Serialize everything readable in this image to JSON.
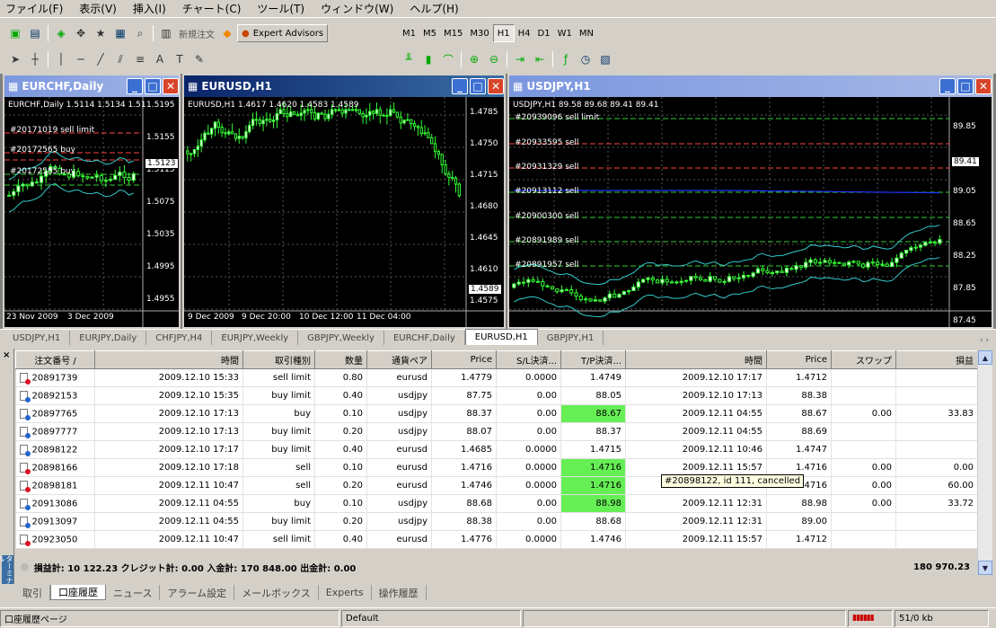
{
  "menu": [
    "ファイル(F)",
    "表示(V)",
    "挿入(I)",
    "チャート(C)",
    "ツール(T)",
    "ウィンドウ(W)",
    "ヘルプ(H)"
  ],
  "toolbar": {
    "new_order": "新規注文",
    "expert_advisors": "Expert Advisors",
    "timeframes": [
      "M1",
      "M5",
      "M15",
      "M30",
      "H1",
      "H4",
      "D1",
      "W1",
      "MN"
    ],
    "active_timeframe": "H1"
  },
  "charts": {
    "eurchf": {
      "title": "EURCHF,Daily",
      "info": "EURCHF,Daily  1.5114 1.5134 1.51",
      "orders": [
        "#20171019 sell limit",
        "#20172565 buy",
        "#20172585 buy"
      ],
      "price_labels": [
        "1.5195",
        "1.5155",
        "1.5115",
        "1.5075",
        "1.5035",
        "1.4995",
        "1.4955"
      ],
      "current_price": "1.5123",
      "date_labels": [
        "23 Nov 2009",
        "3 Dec 2009"
      ]
    },
    "eurusd": {
      "title": "EURUSD,H1",
      "info": "EURUSD,H1  1.4617 1.4620 1.4583 1.4589",
      "price_labels": [
        "1.4785",
        "1.4750",
        "1.4715",
        "1.4680",
        "1.4645",
        "1.4610",
        "1.4575"
      ],
      "current_price": "1.4589",
      "date_labels": [
        "9 Dec 2009",
        "9 Dec 20:00",
        "10 Dec 12:00",
        "11 Dec 04:00"
      ]
    },
    "usdjpy": {
      "title": "USDJPY,H1",
      "info": "USDJPY,H1  89.58 89.68 89.41 89.41",
      "orders": [
        "#20939096 sell limit",
        "#20933595 sell",
        "#20931329 sell",
        "#20913112 sell",
        "#20900300 sell",
        "#20891989 sell",
        "#20891957 sell"
      ],
      "price_labels": [
        "89.85",
        "89.05",
        "88.65",
        "88.25",
        "87.85",
        "87.45"
      ],
      "current_price": "89.41"
    }
  },
  "chart_tabs": [
    "USDJPY,H1",
    "EURJPY,Daily",
    "CHFJPY,H4",
    "EURJPY,Weekly",
    "GBPJPY,Weekly",
    "EURCHF,Daily",
    "EURUSD,H1",
    "GBPJPY,H1"
  ],
  "active_chart_tab": "EURUSD,H1",
  "terminal": {
    "columns": [
      "注文番号 /",
      "時間",
      "取引種別",
      "数量",
      "通貨ペア",
      "Price",
      "S/L決済...",
      "T/P決済...",
      "時間",
      "Price",
      "スワップ",
      "損益"
    ],
    "rows": [
      {
        "ticket": "20891739",
        "open_time": "2009.12.10 15:33",
        "type": "sell limit",
        "size": "0.80",
        "symbol": "eurusd",
        "price": "1.4779",
        "sl": "0.0000",
        "tp": "1.4749",
        "close_time": "2009.12.10 17:17",
        "close_price": "1.4712",
        "swap": "",
        "profit": ""
      },
      {
        "ticket": "20892153",
        "open_time": "2009.12.10 15:35",
        "type": "buy limit",
        "size": "0.40",
        "symbol": "usdjpy",
        "price": "87.75",
        "sl": "0.00",
        "tp": "88.05",
        "close_time": "2009.12.10 17:13",
        "close_price": "88.38",
        "swap": "",
        "profit": ""
      },
      {
        "ticket": "20897765",
        "open_time": "2009.12.10 17:13",
        "type": "buy",
        "size": "0.10",
        "symbol": "usdjpy",
        "price": "88.37",
        "sl": "0.00",
        "tp": "88.67",
        "close_time": "2009.12.11 04:55",
        "close_price": "88.67",
        "swap": "0.00",
        "profit": "33.83"
      },
      {
        "ticket": "20897777",
        "open_time": "2009.12.10 17:13",
        "type": "buy limit",
        "size": "0.20",
        "symbol": "usdjpy",
        "price": "88.07",
        "sl": "0.00",
        "tp": "88.37",
        "close_time": "2009.12.11 04:55",
        "close_price": "88.69",
        "swap": "",
        "profit": ""
      },
      {
        "ticket": "20898122",
        "open_time": "2009.12.10 17:17",
        "type": "buy limit",
        "size": "0.40",
        "symbol": "eurusd",
        "price": "1.4685",
        "sl": "0.0000",
        "tp": "1.4715",
        "close_time": "2009.12.11 10:46",
        "close_price": "1.4747",
        "swap": "",
        "profit": ""
      },
      {
        "ticket": "20898166",
        "open_time": "2009.12.10 17:18",
        "type": "sell",
        "size": "0.10",
        "symbol": "eurusd",
        "price": "1.4716",
        "sl": "0.0000",
        "tp": "1.4716",
        "close_time": "2009.12.11 15:57",
        "close_price": "1.4716",
        "swap": "0.00",
        "profit": "0.00"
      },
      {
        "ticket": "20898181",
        "open_time": "2009.12.11 10:47",
        "type": "sell",
        "size": "0.20",
        "symbol": "eurusd",
        "price": "1.4746",
        "sl": "0.0000",
        "tp": "1.4716",
        "close_time": "2009.12.11 15:57",
        "close_price": "1.4716",
        "swap": "0.00",
        "profit": "60.00"
      },
      {
        "ticket": "20913086",
        "open_time": "2009.12.11 04:55",
        "type": "buy",
        "size": "0.10",
        "symbol": "usdjpy",
        "price": "88.68",
        "sl": "0.00",
        "tp": "88.98",
        "close_time": "2009.12.11 12:31",
        "close_price": "88.98",
        "swap": "0.00",
        "profit": "33.72"
      },
      {
        "ticket": "20913097",
        "open_time": "2009.12.11 04:55",
        "type": "buy limit",
        "size": "0.20",
        "symbol": "usdjpy",
        "price": "88.38",
        "sl": "0.00",
        "tp": "88.68",
        "close_time": "2009.12.11 12:31",
        "close_price": "89.00",
        "swap": "",
        "profit": ""
      },
      {
        "ticket": "20923050",
        "open_time": "2009.12.11 10:47",
        "type": "sell limit",
        "size": "0.40",
        "symbol": "eurusd",
        "price": "1.4776",
        "sl": "0.0000",
        "tp": "1.4746",
        "close_time": "2009.12.11 15:57",
        "close_price": "1.4712",
        "swap": "",
        "profit": ""
      }
    ],
    "totals": "損益計: 10 122.23  クレジット計: 0.00  入金計: 170 848.00  出金計: 0.00",
    "total_balance": "180 970.23",
    "tooltip": "#20898122, id 111, cancelled",
    "tabs": [
      "取引",
      "口座履歴",
      "ニュース",
      "アラーム設定",
      "メールボックス",
      "Experts",
      "操作履歴"
    ],
    "active_tab": "口座履歴",
    "side_label": "ターミナル"
  },
  "status": {
    "left": "口座履歴ページ",
    "profile": "Default",
    "traffic": "51/0 kb"
  }
}
